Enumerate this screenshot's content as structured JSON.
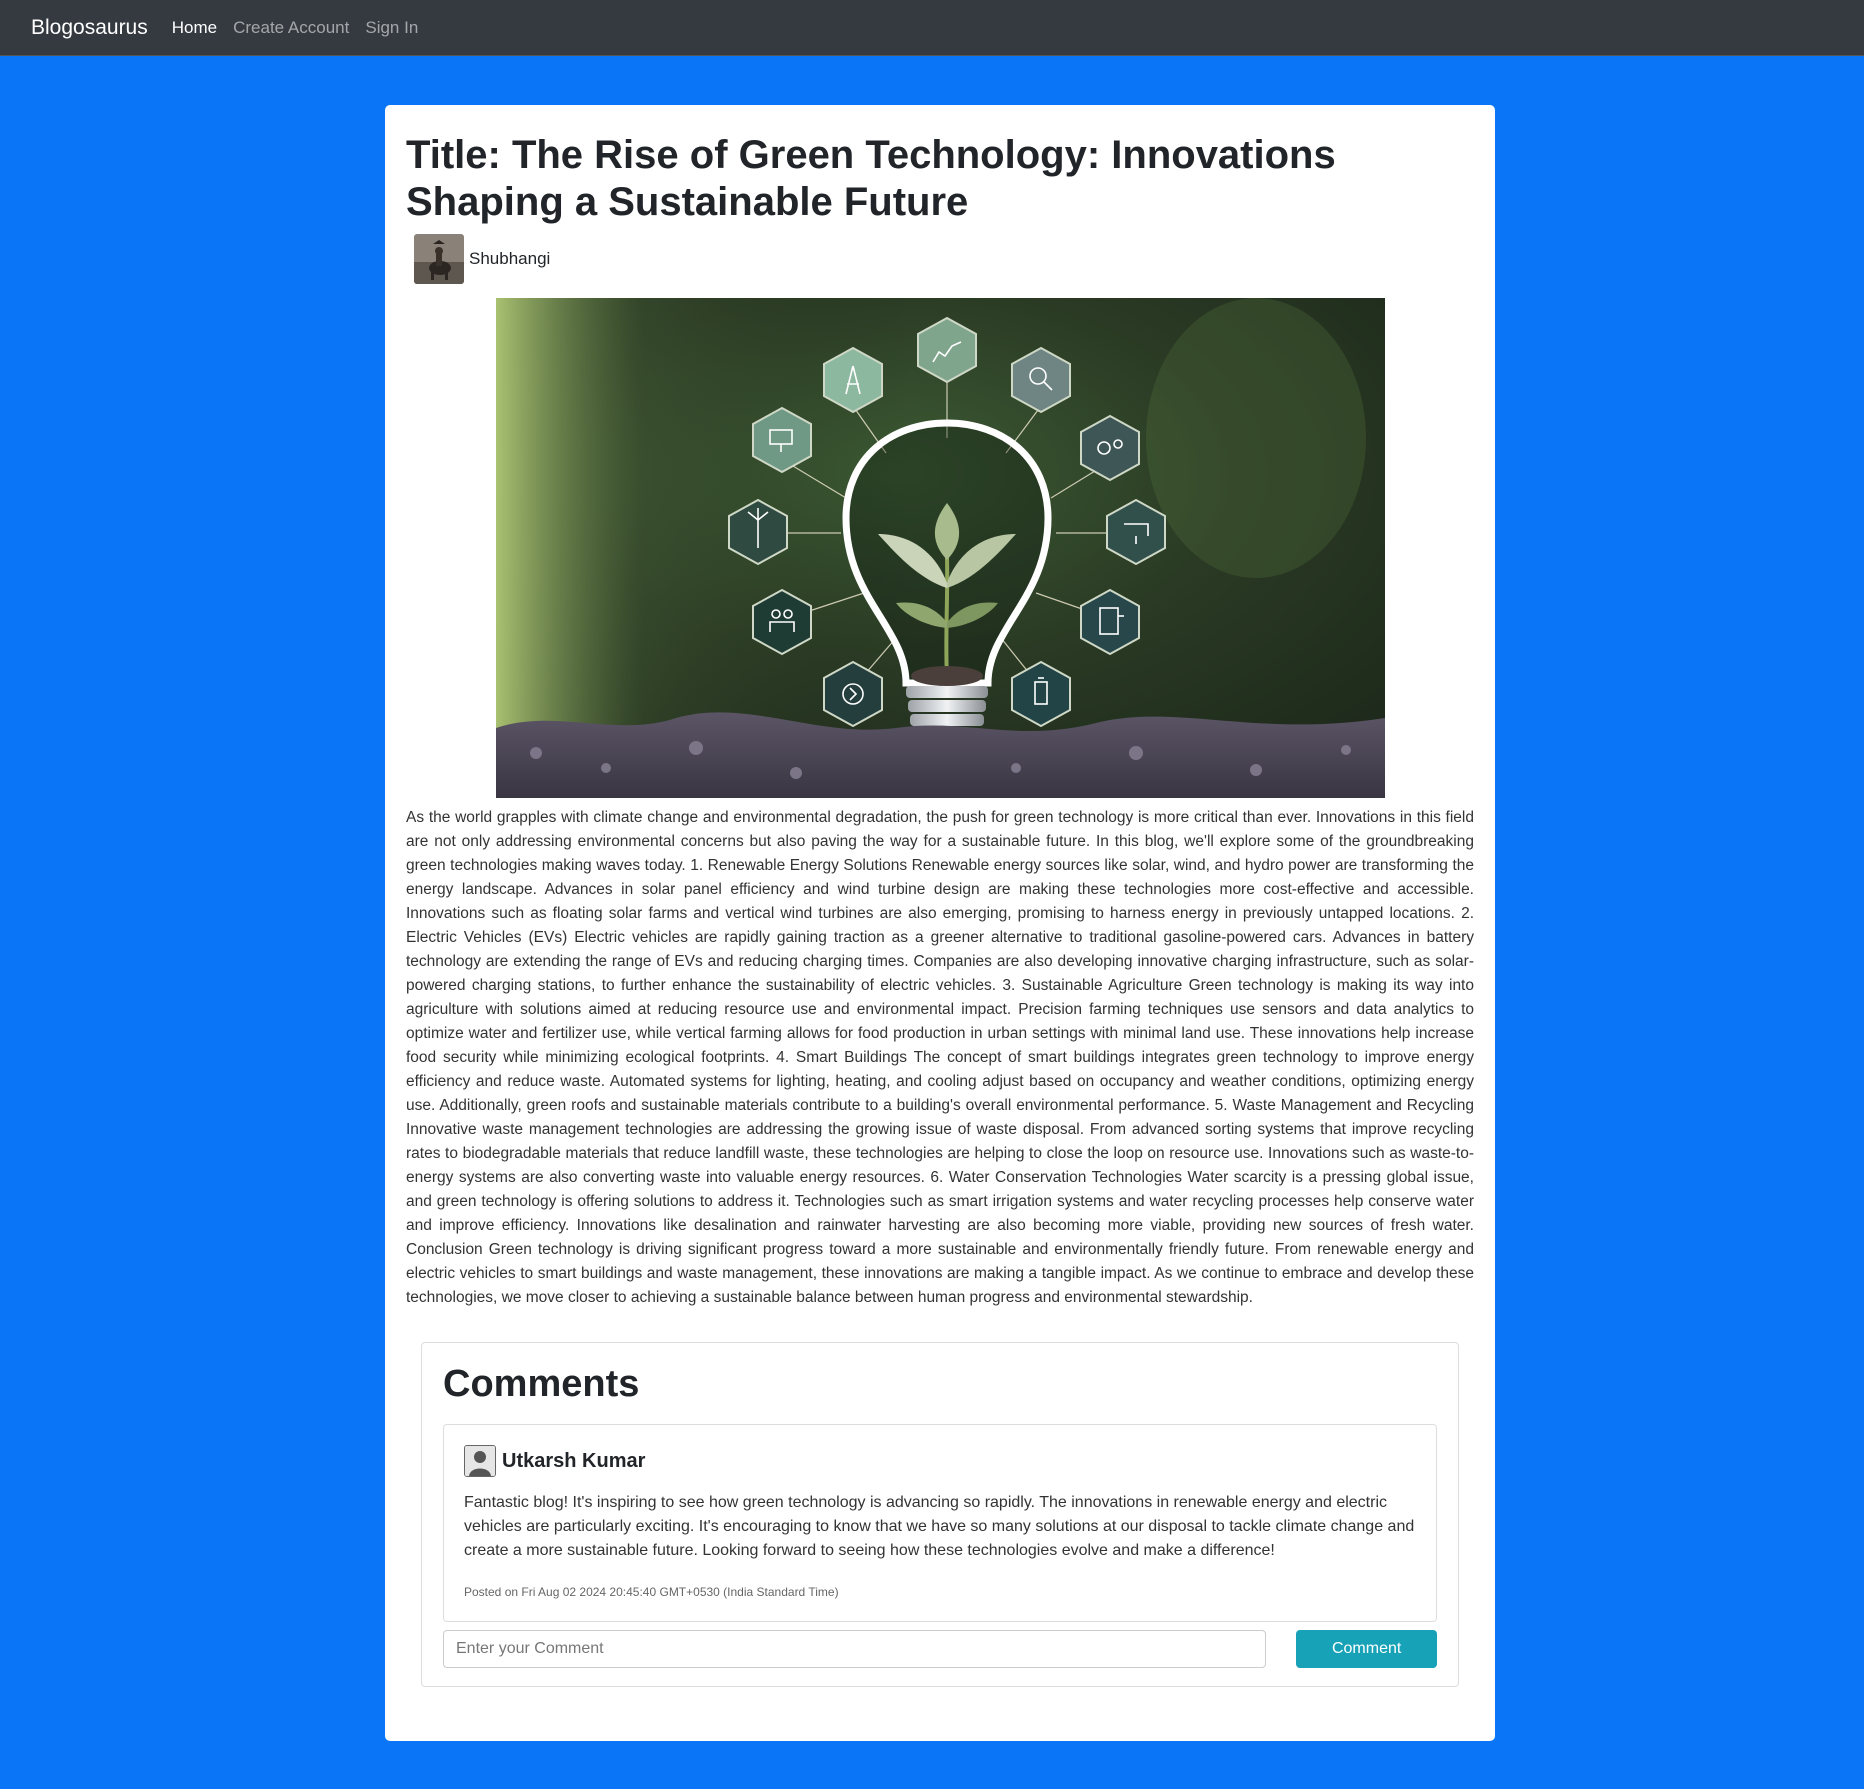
{
  "navbar": {
    "brand": "Blogosaurus",
    "links": [
      "Home",
      "Create Account",
      "Sign In"
    ]
  },
  "post": {
    "title": "Title: The Rise of Green Technology: Innovations Shaping a Sustainable Future",
    "author": "Shubhangi",
    "image_alt": "lightbulb-with-seedling-and-green-tech-icons",
    "content": "As the world grapples with climate change and environmental degradation, the push for green technology is more critical than ever. Innovations in this field are not only addressing environmental concerns but also paving the way for a sustainable future. In this blog, we'll explore some of the groundbreaking green technologies making waves today. 1. Renewable Energy Solutions Renewable energy sources like solar, wind, and hydro power are transforming the energy landscape. Advances in solar panel efficiency and wind turbine design are making these technologies more cost-effective and accessible. Innovations such as floating solar farms and vertical wind turbines are also emerging, promising to harness energy in previously untapped locations. 2. Electric Vehicles (EVs) Electric vehicles are rapidly gaining traction as a greener alternative to traditional gasoline-powered cars. Advances in battery technology are extending the range of EVs and reducing charging times. Companies are also developing innovative charging infrastructure, such as solar-powered charging stations, to further enhance the sustainability of electric vehicles. 3. Sustainable Agriculture Green technology is making its way into agriculture with solutions aimed at reducing resource use and environmental impact. Precision farming techniques use sensors and data analytics to optimize water and fertilizer use, while vertical farming allows for food production in urban settings with minimal land use. These innovations help increase food security while minimizing ecological footprints. 4. Smart Buildings The concept of smart buildings integrates green technology to improve energy efficiency and reduce waste. Automated systems for lighting, heating, and cooling adjust based on occupancy and weather conditions, optimizing energy use. Additionally, green roofs and sustainable materials contribute to a building's overall environmental performance. 5. Waste Management and Recycling Innovative waste management technologies are addressing the growing issue of waste disposal. From advanced sorting systems that improve recycling rates to biodegradable materials that reduce landfill waste, these technologies are helping to close the loop on resource use. Innovations such as waste-to-energy systems are also converting waste into valuable energy resources. 6. Water Conservation Technologies Water scarcity is a pressing global issue, and green technology is offering solutions to address it. Technologies such as smart irrigation systems and water recycling processes help conserve water and improve efficiency. Innovations like desalination and rainwater harvesting are also becoming more viable, providing new sources of fresh water. Conclusion Green technology is driving significant progress toward a more sustainable and environmentally friendly future. From renewable energy and electric vehicles to smart buildings and waste management, these innovations are making a tangible impact. As we continue to embrace and develop these technologies, we move closer to achieving a sustainable balance between human progress and environmental stewardship."
  },
  "comments": {
    "heading": "Comments",
    "items": [
      {
        "author": "Utkarsh Kumar",
        "body": "Fantastic blog! It's inspiring to see how green technology is advancing so rapidly. The innovations in renewable energy and electric vehicles are particularly exciting. It's encouraging to know that we have so many solutions at our disposal to tackle climate change and create a more sustainable future. Looking forward to seeing how these technologies evolve and make a difference!",
        "date": "Posted on Fri Aug 02 2024 20:45:40 GMT+0530 (India Standard Time)"
      }
    ],
    "input_placeholder": "Enter your Comment",
    "button_label": "Comment"
  },
  "colors": {
    "page_bg": "#0a76f7",
    "navbar_bg": "#343a40",
    "button_bg": "#17a2b8"
  }
}
